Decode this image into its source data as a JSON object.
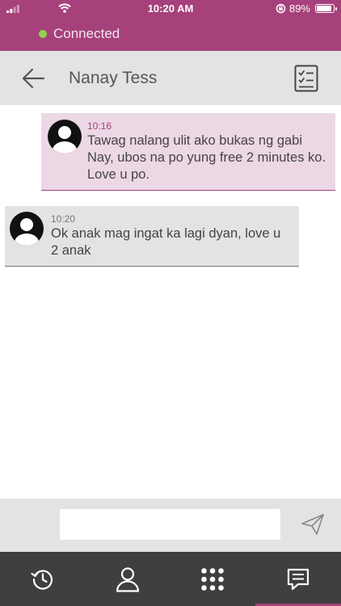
{
  "status_bar": {
    "time": "10:20 AM",
    "battery_text": "89%",
    "battery_level": 0.89,
    "signal_icon": "signal-icon",
    "wifi_icon": "wifi-icon",
    "orientation_lock_icon": "orientation-lock-icon",
    "battery_icon": "battery-icon"
  },
  "connection": {
    "status": "Connected",
    "dot_color": "#8fd14f"
  },
  "header": {
    "contact_name": "Nanay Tess",
    "back_icon": "arrow-left-icon",
    "action_icon": "checklist-icon"
  },
  "messages": [
    {
      "direction": "sent",
      "time": "10:16",
      "text": "Tawag nalang ulit ako bukas ng gabi\nNay, ubos na po yung free 2 minutes ko.\nLove u po."
    },
    {
      "direction": "received",
      "time": "10:20",
      "text": "Ok anak mag ingat ka lagi dyan, love u\n2 anak"
    }
  ],
  "compose": {
    "value": "",
    "placeholder": "",
    "send_icon": "send-icon"
  },
  "tabs": [
    {
      "name": "history",
      "icon": "history-icon",
      "active": false
    },
    {
      "name": "contacts",
      "icon": "person-icon",
      "active": false
    },
    {
      "name": "dialpad",
      "icon": "dialpad-icon",
      "active": false
    },
    {
      "name": "messages",
      "icon": "chat-icon",
      "active": true
    }
  ],
  "colors": {
    "brand": "#a6417b",
    "sent_bubble": "#ecd7e5",
    "received_bubble": "#e3e3e3",
    "tabbar": "#3f3f3f"
  }
}
